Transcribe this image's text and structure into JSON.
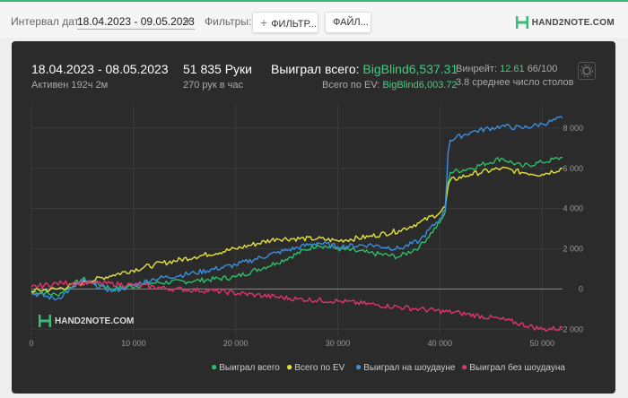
{
  "toolbar": {
    "interval_label": "Интервал дат:",
    "date_range": "18.04.2023 - 09.05.2023",
    "filters_label": "Фильтры:",
    "filter_button": "ФИЛЬТР...",
    "file_button": "ФАЙЛ...",
    "logo_text": "HAND2NOTE.COM"
  },
  "stats": {
    "period": "18.04.2023 - 08.05.2023",
    "active": "Активен 192ч 2м",
    "hands": "51 835 Руки",
    "hands_per_hour": "270 рук в час",
    "won_label": "Выиграл всего:",
    "won_value": "BigBlind6,537.31",
    "ev_label": "Всего по EV:",
    "ev_value": "BigBlind6,003.72",
    "winrate_label": "Винрейт:",
    "winrate_value": "12.61",
    "winrate_tail": "66/100",
    "tables": "3.8 среднее число столов"
  },
  "watermark": "HAND2NOTE.COM",
  "chart_data": {
    "type": "line",
    "x_ticks": [
      "0",
      "10 000",
      "20 000",
      "30 000",
      "40 000",
      "50 000"
    ],
    "y_ticks": [
      "8 000",
      "6 000",
      "4 000",
      "2 000",
      "0",
      "-2 000"
    ],
    "xlim": [
      0,
      52000
    ],
    "ylim": [
      -2300,
      9200
    ],
    "grid": true,
    "legend_position": "bottom-right",
    "series": [
      {
        "name": "Выиграл всего",
        "color": "#2ebd6b",
        "x": [
          0,
          2500,
          5000,
          8000,
          12000,
          16000,
          20000,
          24000,
          28000,
          30000,
          33000,
          36000,
          38000,
          40000,
          40500,
          40800,
          41000,
          43000,
          46000,
          48000,
          50000,
          52000
        ],
        "y": [
          -100,
          -300,
          500,
          0,
          300,
          400,
          600,
          1300,
          2200,
          2000,
          1800,
          1600,
          2100,
          3300,
          3800,
          5300,
          5800,
          6000,
          6500,
          6100,
          6300,
          6537
        ]
      },
      {
        "name": "Всего по EV",
        "color": "#e4e23a",
        "x": [
          0,
          2500,
          5000,
          8000,
          12000,
          16000,
          20000,
          24000,
          28000,
          30000,
          33000,
          36000,
          38000,
          40000,
          40500,
          40800,
          41000,
          43000,
          46000,
          48000,
          50000,
          52000
        ],
        "y": [
          -100,
          0,
          300,
          700,
          1200,
          1600,
          2000,
          2500,
          2500,
          2400,
          2600,
          2900,
          3300,
          3800,
          4100,
          5100,
          5400,
          5700,
          6000,
          5800,
          5700,
          6004
        ]
      },
      {
        "name": "Выиграл на шоудауне",
        "color": "#3b8fe0",
        "x": [
          0,
          2500,
          5000,
          8000,
          12000,
          16000,
          20000,
          24000,
          28000,
          30000,
          33000,
          36000,
          38000,
          40000,
          40500,
          40800,
          41000,
          43000,
          46000,
          48000,
          50000,
          52000
        ],
        "y": [
          -200,
          -500,
          400,
          -100,
          500,
          800,
          1200,
          1800,
          2300,
          2100,
          2200,
          2000,
          2400,
          3500,
          3900,
          6800,
          7400,
          7800,
          8100,
          8000,
          8200,
          8500
        ]
      },
      {
        "name": "Выиграл без шоудауна",
        "color": "#e0356c",
        "x": [
          0,
          3000,
          6000,
          10000,
          14000,
          18000,
          22000,
          26000,
          30000,
          34000,
          38000,
          42000,
          46000,
          50000,
          52000
        ],
        "y": [
          100,
          300,
          300,
          200,
          0,
          -100,
          -300,
          -500,
          -600,
          -800,
          -1000,
          -1200,
          -1500,
          -2000,
          -1950
        ]
      }
    ]
  }
}
